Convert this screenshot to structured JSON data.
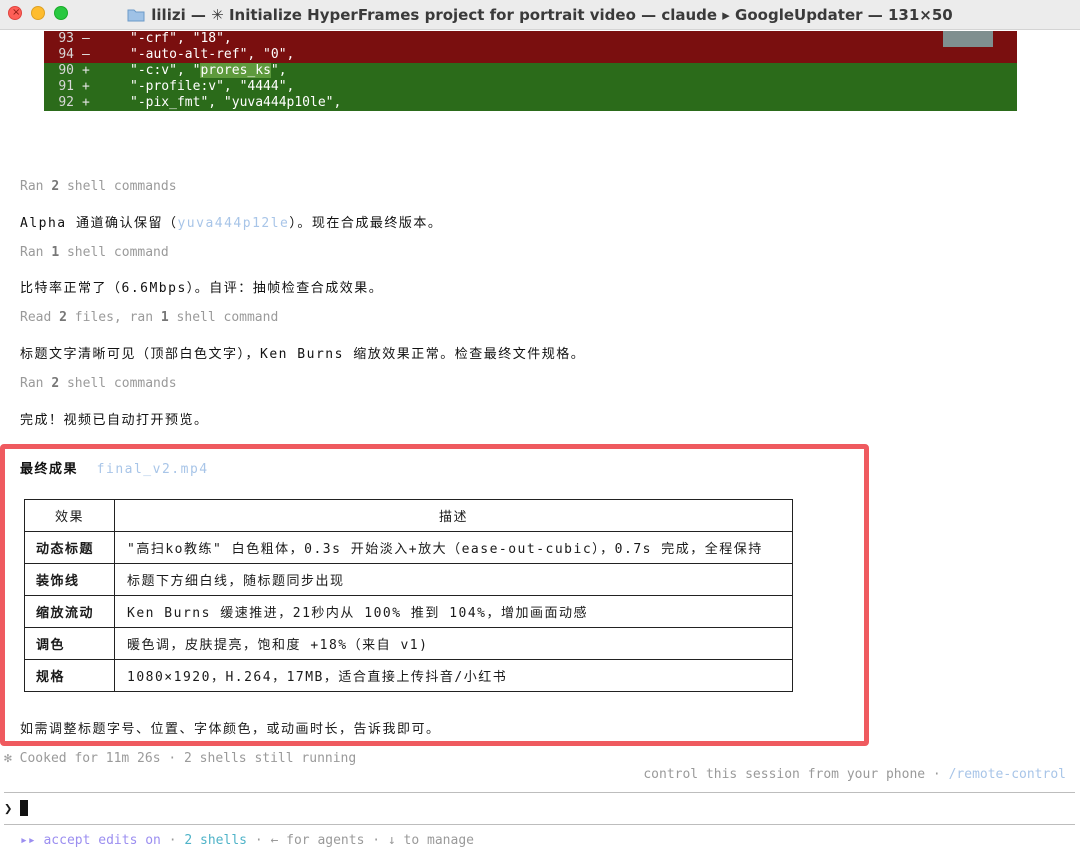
{
  "window": {
    "title": "lilizi — ✳ Initialize HyperFrames project for portrait video — claude ▸ GoogleUpdater — 131×50"
  },
  "diff": [
    {
      "type": "del",
      "ln": "93",
      "sign": "–",
      "code": "\"-crf\", \"18\","
    },
    {
      "type": "del",
      "ln": "94",
      "sign": "–",
      "code": "\"-auto-alt-ref\", \"0\","
    },
    {
      "type": "add",
      "ln": "90",
      "sign": "+",
      "code_pre": "\"-c:v\", \"",
      "code_hl": "prores_ks",
      "code_post": "\","
    },
    {
      "type": "add",
      "ln": "91",
      "sign": "+",
      "code": "\"-profile:v\", \"4444\","
    },
    {
      "type": "add",
      "ln": "92",
      "sign": "+",
      "code": "\"-pix_fmt\", \"yuva444p10le\","
    }
  ],
  "log": {
    "l1_pre": "Ran ",
    "l1_num": "2",
    "l1_post": " shell commands",
    "m1_pre": "Alpha 通道确认保留（",
    "m1_link": "yuva444p12le",
    "m1_post": "）。现在合成最终版本。",
    "l2_pre": "Ran ",
    "l2_num": "1",
    "l2_post": " shell command",
    "m2": "比特率正常了（6.6Mbps）。自评：抽帧检查合成效果。",
    "l3_a": "Read ",
    "l3_n1": "2",
    "l3_b": " files, ran ",
    "l3_n2": "1",
    "l3_c": " shell command",
    "m3": "标题文字清晰可见（顶部白色文字），Ken Burns 缩放效果正常。检查最终文件规格。",
    "l4_pre": "Ran ",
    "l4_num": "2",
    "l4_post": " shell commands",
    "m4": "完成！视频已自动打开预览。"
  },
  "result": {
    "title": "最终成果",
    "file": "final_v2.mp4",
    "headers": [
      "效果",
      "描述"
    ],
    "rows": [
      {
        "k": "动态标题",
        "v": "\"高扫ko教练\" 白色粗体，0.3s 开始淡入+放大（ease-out-cubic），0.7s 完成，全程保持"
      },
      {
        "k": "装饰线",
        "v": "标题下方细白线，随标题同步出现"
      },
      {
        "k": "缩放流动",
        "v": "Ken Burns 缓速推进，21秒内从 100% 推到 104%，增加画面动感"
      },
      {
        "k": "调色",
        "v": "暖色调，皮肤提亮，饱和度 +18%（来自 v1)"
      },
      {
        "k": "规格",
        "v": "1080×1920，H.264，17MB，适合直接上传抖音/小红书"
      }
    ],
    "footer": "如需调整标题字号、位置、字体颜色，或动画时长，告诉我即可。"
  },
  "status": {
    "cooked": "✻ Cooked for 11m 26s · 2 shells still running",
    "remote_pre": "control this session from your phone · ",
    "remote_link": "/remote-control"
  },
  "prompt": {
    "symbol": "❯"
  },
  "bottom": {
    "accept": "▸▸ accept edits on",
    "dot1": " · ",
    "shells": "2 shells",
    "rest": " · ← for agents · ↓ to manage"
  }
}
